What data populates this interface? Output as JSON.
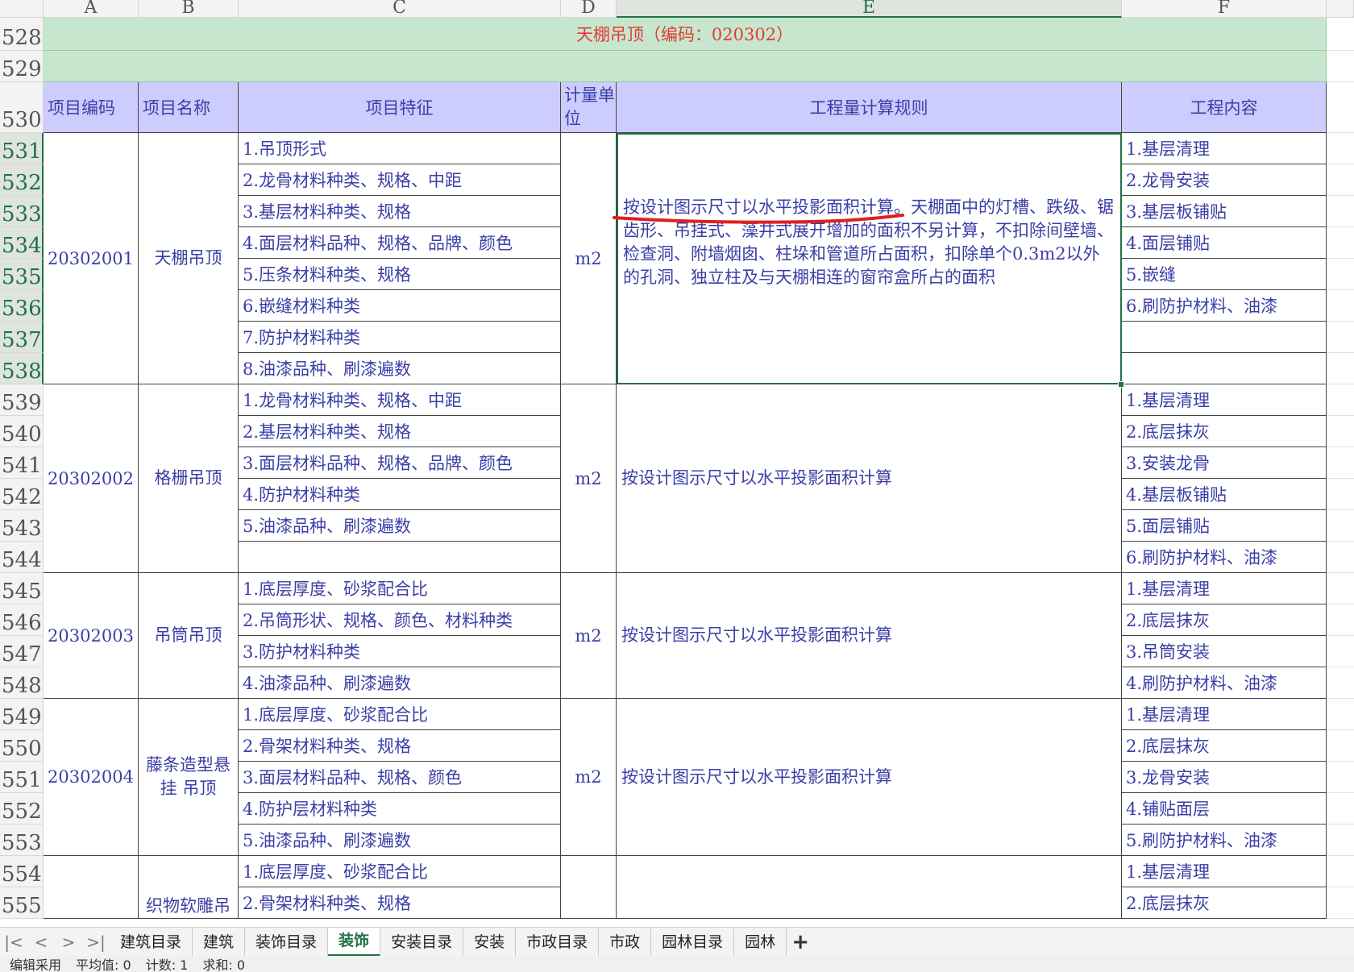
{
  "columns": [
    "A",
    "B",
    "C",
    "D",
    "E",
    "F"
  ],
  "rows": [
    "528",
    "529",
    "530",
    "531",
    "532",
    "533",
    "534",
    "535",
    "536",
    "537",
    "538",
    "539",
    "540",
    "541",
    "542",
    "543",
    "544",
    "545",
    "546",
    "547",
    "548",
    "549",
    "550",
    "551",
    "552",
    "553",
    "554",
    "555"
  ],
  "banner_title": "天棚吊顶（编码：020302）",
  "headers": {
    "code": "项目编码",
    "name": "项目名称",
    "feature": "项目特征",
    "unit": "计量单位",
    "rule": "工程量计算规则",
    "content": "工程内容"
  },
  "items": [
    {
      "code": "20302001",
      "name": "天棚吊顶",
      "unit": "m2",
      "rule": "按设计图示尺寸以水平投影面积计算。天棚面中的灯槽、跌级、锯齿形、吊挂式、藻井式展开增加的面积不另计算，不扣除间壁墙、检查洞、附墙烟囱、柱垛和管道所占面积，扣除单个0.3m2以外的孔洞、独立柱及与天棚相连的窗帘盒所占的面积",
      "features": [
        "1.吊顶形式",
        "2.龙骨材料种类、规格、中距",
        "3.基层材料种类、规格",
        "4.面层材料品种、规格、品牌、颜色",
        "5.压条材料种类、规格",
        "6.嵌缝材料种类",
        "7.防护材料种类",
        "8.油漆品种、刷漆遍数"
      ],
      "contents": [
        "1.基层清理",
        "2.龙骨安装",
        "3.基层板铺贴",
        "4.面层铺贴",
        "5.嵌缝",
        "6.刷防护材料、油漆",
        "",
        ""
      ]
    },
    {
      "code": "20302002",
      "name": "格栅吊顶",
      "unit": "m2",
      "rule": "按设计图示尺寸以水平投影面积计算",
      "features": [
        "1.龙骨材料种类、规格、中距",
        "2.基层材料种类、规格",
        "3.面层材料品种、规格、品牌、颜色",
        "4.防护材料种类",
        "5.油漆品种、刷漆遍数",
        ""
      ],
      "contents": [
        "1.基层清理",
        "2.底层抹灰",
        "3.安装龙骨",
        "4.基层板铺贴",
        "5.面层铺贴",
        "6.刷防护材料、油漆"
      ]
    },
    {
      "code": "20302003",
      "name": "吊筒吊顶",
      "unit": "m2",
      "rule": "按设计图示尺寸以水平投影面积计算",
      "features": [
        "1.底层厚度、砂浆配合比",
        "2.吊筒形状、规格、颜色、材料种类",
        "3.防护材料种类",
        "4.油漆品种、刷漆遍数"
      ],
      "contents": [
        "1.基层清理",
        "2.底层抹灰",
        "3.吊筒安装",
        "4.刷防护材料、油漆"
      ]
    },
    {
      "code": "20302004",
      "name": "藤条造型悬挂 吊顶",
      "unit": "m2",
      "rule": "按设计图示尺寸以水平投影面积计算",
      "features": [
        "1.底层厚度、砂浆配合比",
        "2.骨架材料种类、规格",
        "3.面层材料品种、规格、颜色",
        "4.防护层材料种类",
        "5.油漆品种、刷漆遍数"
      ],
      "contents": [
        "1.基层清理",
        "2.底层抹灰",
        "3.龙骨安装",
        "4.铺贴面层",
        "5.刷防护材料、油漆"
      ]
    },
    {
      "code": "",
      "name": "织物软雕吊",
      "unit": "",
      "rule": "",
      "features": [
        "1.底层厚度、砂浆配合比",
        "2.骨架材料种类、规格"
      ],
      "contents": [
        "1.基层清理",
        "2.底层抹灰"
      ]
    }
  ],
  "tabs": {
    "nav": [
      "|<",
      "<",
      ">",
      ">|"
    ],
    "sheets": [
      "建筑目录",
      "建筑",
      "装饰目录",
      "装饰",
      "安装目录",
      "安装",
      "市政目录",
      "市政",
      "园林目录",
      "园林"
    ],
    "active_index": 3,
    "add": "+"
  },
  "status": {
    "mode": "编辑采用",
    "average": "平均值: 0",
    "count": "计数: 1",
    "sum": "求和: 0"
  }
}
